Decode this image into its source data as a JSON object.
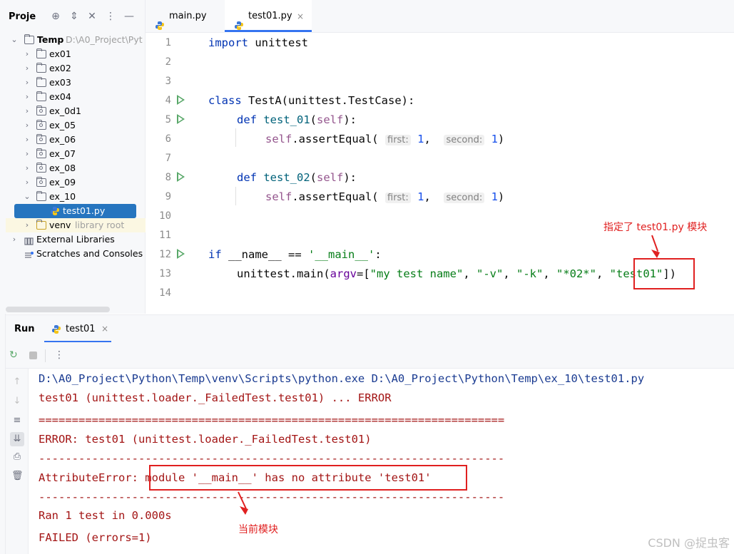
{
  "project": {
    "title": "Proje",
    "root_name": "Temp",
    "root_path": "D:\\A0_Project\\Pyt",
    "items": [
      {
        "label": "ex01"
      },
      {
        "label": "ex02"
      },
      {
        "label": "ex03"
      },
      {
        "label": "ex04"
      },
      {
        "label": "ex_0d1"
      },
      {
        "label": "ex_05"
      },
      {
        "label": "ex_06"
      },
      {
        "label": "ex_07"
      },
      {
        "label": "ex_08"
      },
      {
        "label": "ex_09"
      },
      {
        "label": "ex_10"
      }
    ],
    "selected_file": "test01.py",
    "venv_label": "venv",
    "venv_hint": "library root",
    "external_libraries": "External Libraries",
    "scratches": "Scratches and Consoles"
  },
  "tabs": [
    {
      "label": "main.py"
    },
    {
      "label": "test01.py"
    }
  ],
  "editor": {
    "line_numbers": [
      "1",
      "2",
      "3",
      "4",
      "5",
      "6",
      "7",
      "8",
      "9",
      "10",
      "11",
      "12",
      "13",
      "14"
    ],
    "import_kw": "import",
    "import_mod": "unittest",
    "class_kw": "class",
    "class_decl": "TestA(unittest.TestCase):",
    "def_kw": "def",
    "test1_name": "test_01",
    "test2_name": "test_02",
    "self_param": "self",
    "assert_call": ".assertEqual(",
    "first_hint": "first:",
    "second_hint": "second:",
    "one": "1",
    "if_kw": "if",
    "main_cond": "__name__ == ",
    "main_str": "'__main__'",
    "main_call": "unittest.main(",
    "argv_param": "argv",
    "arg1": "\"my test name\"",
    "arg2": "\"-v\"",
    "arg3": "\"-k\"",
    "arg4": "\"*02*\"",
    "arg5": "\"test01\""
  },
  "annotations": {
    "top": "指定了 test01.py 模块",
    "bottom": "当前模块"
  },
  "run": {
    "title": "Run",
    "tab_label": "test01",
    "output": [
      "D:\\A0_Project\\Python\\Temp\\venv\\Scripts\\python.exe D:\\A0_Project\\Python\\Temp\\ex_10\\test01.py",
      "test01 (unittest.loader._FailedTest.test01) ... ERROR",
      "======================================================================",
      "ERROR: test01 (unittest.loader._FailedTest.test01)",
      "----------------------------------------------------------------------",
      "AttributeError: module '__main__' has no attribute 'test01'",
      "----------------------------------------------------------------------",
      "Ran 1 test in 0.000s",
      "FAILED (errors=1)"
    ]
  },
  "watermark": "CSDN @捉虫客"
}
